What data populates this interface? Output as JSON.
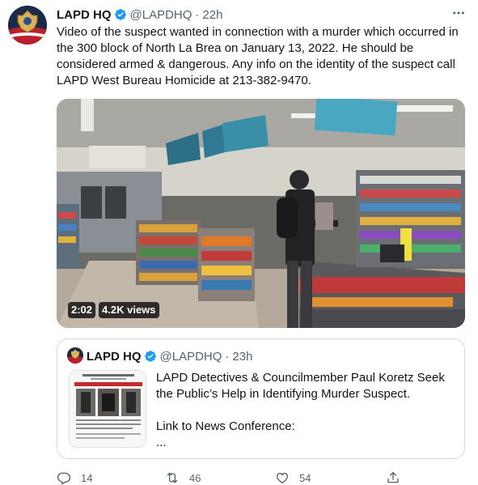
{
  "tweet": {
    "author_name": "LAPD HQ",
    "author_handle": "@LAPDHQ",
    "separator": "·",
    "time": "22h",
    "more_icon": "more-horizontal-icon",
    "text": "Video of the suspect wanted in connection with a murder which occurred in\nthe 300 block of North La Brea on January 13, 2022. He should be\nconsidered armed & dangerous. Any info on the identity of the suspect call\nLAPD West Bureau Homicide at 213-382-9470."
  },
  "video": {
    "duration": "2:02",
    "views": "4.2K views"
  },
  "quoted_tweet": {
    "author_name": "LAPD HQ",
    "author_handle": "@LAPDHQ",
    "separator": "·",
    "time": "23h",
    "text": "LAPD Detectives & Councilmember Paul Koretz Seek\nthe Public’s Help in Identifying Murder Suspect.\n\nLink to News Conference:\n..."
  },
  "actions": {
    "reply_count": "14",
    "retweet_count": "46",
    "like_count": "54"
  },
  "colors": {
    "text_primary": "#0f1419",
    "text_secondary": "#536471",
    "verified_blue": "#1d9bf0",
    "border": "#cfd9de"
  }
}
